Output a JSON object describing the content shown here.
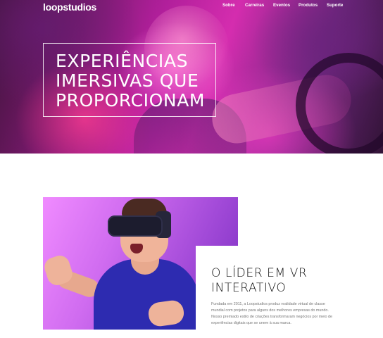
{
  "header": {
    "logo": "loopstudios",
    "nav": [
      "Sobre",
      "Carreiras",
      "Eventos",
      "Produtos",
      "Suporte"
    ]
  },
  "hero": {
    "headline_lines": [
      "EXPERIÊNCIAS",
      "IMERSIVAS QUE",
      "PROPORCIONAM"
    ]
  },
  "about": {
    "title_lines": [
      "O LÍDER EM VR",
      "INTERATIVO"
    ],
    "text_lines": [
      "Fundada em 2011, a Loopstudios produz realidade virtual de classe",
      "mundial com projetos para alguns dos melhores empresas do mundo.",
      "Nosso premiado estilo de criações transformaram negócios por meio de",
      "experiências digitais que se unem à sua marca."
    ]
  },
  "colors": {
    "hero_accent": "#e02fb8",
    "hero_dark": "#4a1746",
    "photo_bg": "#d06cf0",
    "title_text": "#111111",
    "body_text": "#777777"
  },
  "icons": {
    "hero_image": "vr-gamer-photo",
    "about_image": "vr-headset-man-photo"
  }
}
